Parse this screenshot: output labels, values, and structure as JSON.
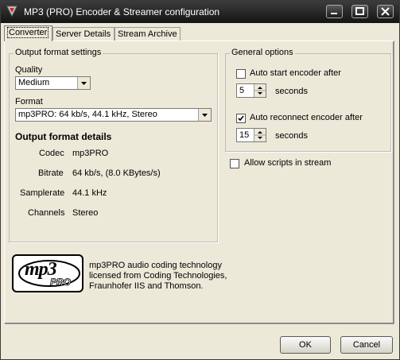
{
  "window": {
    "title": "MP3 (PRO) Encoder & Streamer configuration"
  },
  "tabs": [
    {
      "label": "Converter"
    },
    {
      "label": "Server Details"
    },
    {
      "label": "Stream Archive"
    }
  ],
  "output_format": {
    "group_title": "Output format settings",
    "quality_label": "Quality",
    "quality_value": "Medium",
    "format_label": "Format",
    "format_value": "mp3PRO: 64 kb/s, 44.1 kHz, Stereo",
    "details_heading": "Output format details",
    "details": [
      {
        "key": "Codec",
        "value": "mp3PRO"
      },
      {
        "key": "Bitrate",
        "value": "64 kb/s, (8.0 KBytes/s)"
      },
      {
        "key": "Samplerate",
        "value": "44.1 kHz"
      },
      {
        "key": "Channels",
        "value": "Stereo"
      }
    ]
  },
  "general": {
    "group_title": "General options",
    "auto_start_label": "Auto start encoder after",
    "auto_start_checked": false,
    "auto_start_value": "5",
    "auto_start_unit": "seconds",
    "auto_reconnect_label": "Auto reconnect encoder after",
    "auto_reconnect_checked": true,
    "auto_reconnect_value": "15",
    "auto_reconnect_unit": "seconds",
    "allow_scripts_label": "Allow scripts in stream",
    "allow_scripts_checked": false
  },
  "logo": {
    "text_main": "mp3",
    "text_sub": "PRO"
  },
  "about": {
    "line1": "mp3PRO audio coding technology",
    "line2": "licensed from Coding Technologies,",
    "line3": "Fraunhofer IIS and Thomson."
  },
  "buttons": {
    "ok": "OK",
    "cancel": "Cancel"
  }
}
